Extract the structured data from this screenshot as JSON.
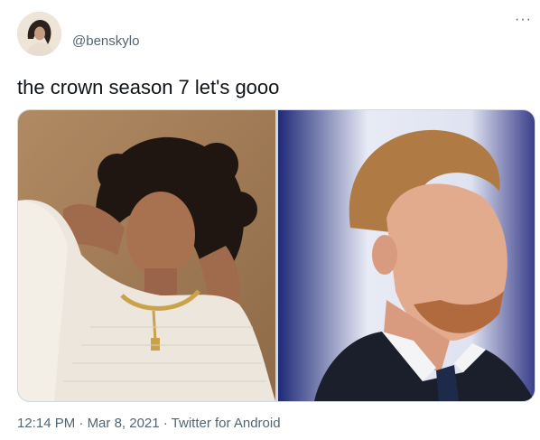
{
  "author": {
    "handle": "@benskylo",
    "avatar_icon": "profile-photo"
  },
  "more_icon": "ellipsis-icon",
  "more_glyph": "···",
  "tweet": {
    "text": "the crown season 7 let's gooo"
  },
  "media": {
    "photos": [
      {
        "name": "photo-woman-curly-hair"
      },
      {
        "name": "photo-man-red-hair-suit"
      }
    ]
  },
  "meta": {
    "time": "12:14 PM",
    "separator": " · ",
    "date": "Mar 8, 2021",
    "source": "Twitter for Android"
  },
  "colors": {
    "text": "#0f1419",
    "secondary": "#536471",
    "border": "#cfd9de"
  }
}
